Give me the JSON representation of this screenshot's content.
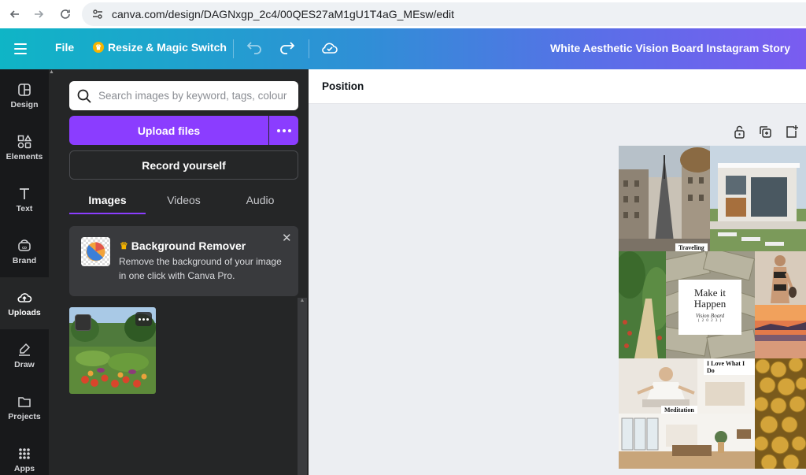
{
  "browser": {
    "url": "canva.com/design/DAGNxgp_2c4/00QES27aM1gU1T4aG_MEsw/edit"
  },
  "topbar": {
    "file_label": "File",
    "resize_label": "Resize & Magic Switch",
    "doc_title": "White Aesthetic Vision Board Instagram Story"
  },
  "rail": {
    "items": [
      {
        "label": "Design",
        "icon": "design-icon"
      },
      {
        "label": "Elements",
        "icon": "elements-icon"
      },
      {
        "label": "Text",
        "icon": "text-icon"
      },
      {
        "label": "Brand",
        "icon": "brand-icon"
      },
      {
        "label": "Uploads",
        "icon": "uploads-icon"
      },
      {
        "label": "Draw",
        "icon": "draw-icon"
      },
      {
        "label": "Projects",
        "icon": "projects-icon"
      },
      {
        "label": "Apps",
        "icon": "apps-icon"
      }
    ],
    "active": "Uploads"
  },
  "panel": {
    "search_placeholder": "Search images by keyword, tags, colour",
    "upload_label": "Upload files",
    "record_label": "Record yourself",
    "tabs": [
      "Images",
      "Videos",
      "Audio"
    ],
    "active_tab": "Images",
    "promo": {
      "title": "Background Remover",
      "text": "Remove the background of your image in one click with Canva Pro."
    }
  },
  "canvas": {
    "position_label": "Position",
    "board": {
      "caption_traveling": "Traveling",
      "caption_love": "I Love What I Do",
      "caption_meditation": "Meditation",
      "make_title": "Make it Happen",
      "make_sub": "Vision Board",
      "make_year": "( 2 0 2 3 )"
    }
  },
  "colors": {
    "accent_purple": "#8b3dff",
    "rail_bg": "#18191b",
    "panel_bg": "#252627",
    "gradient_start": "#0fb5c6",
    "gradient_end": "#7a5cf0"
  }
}
